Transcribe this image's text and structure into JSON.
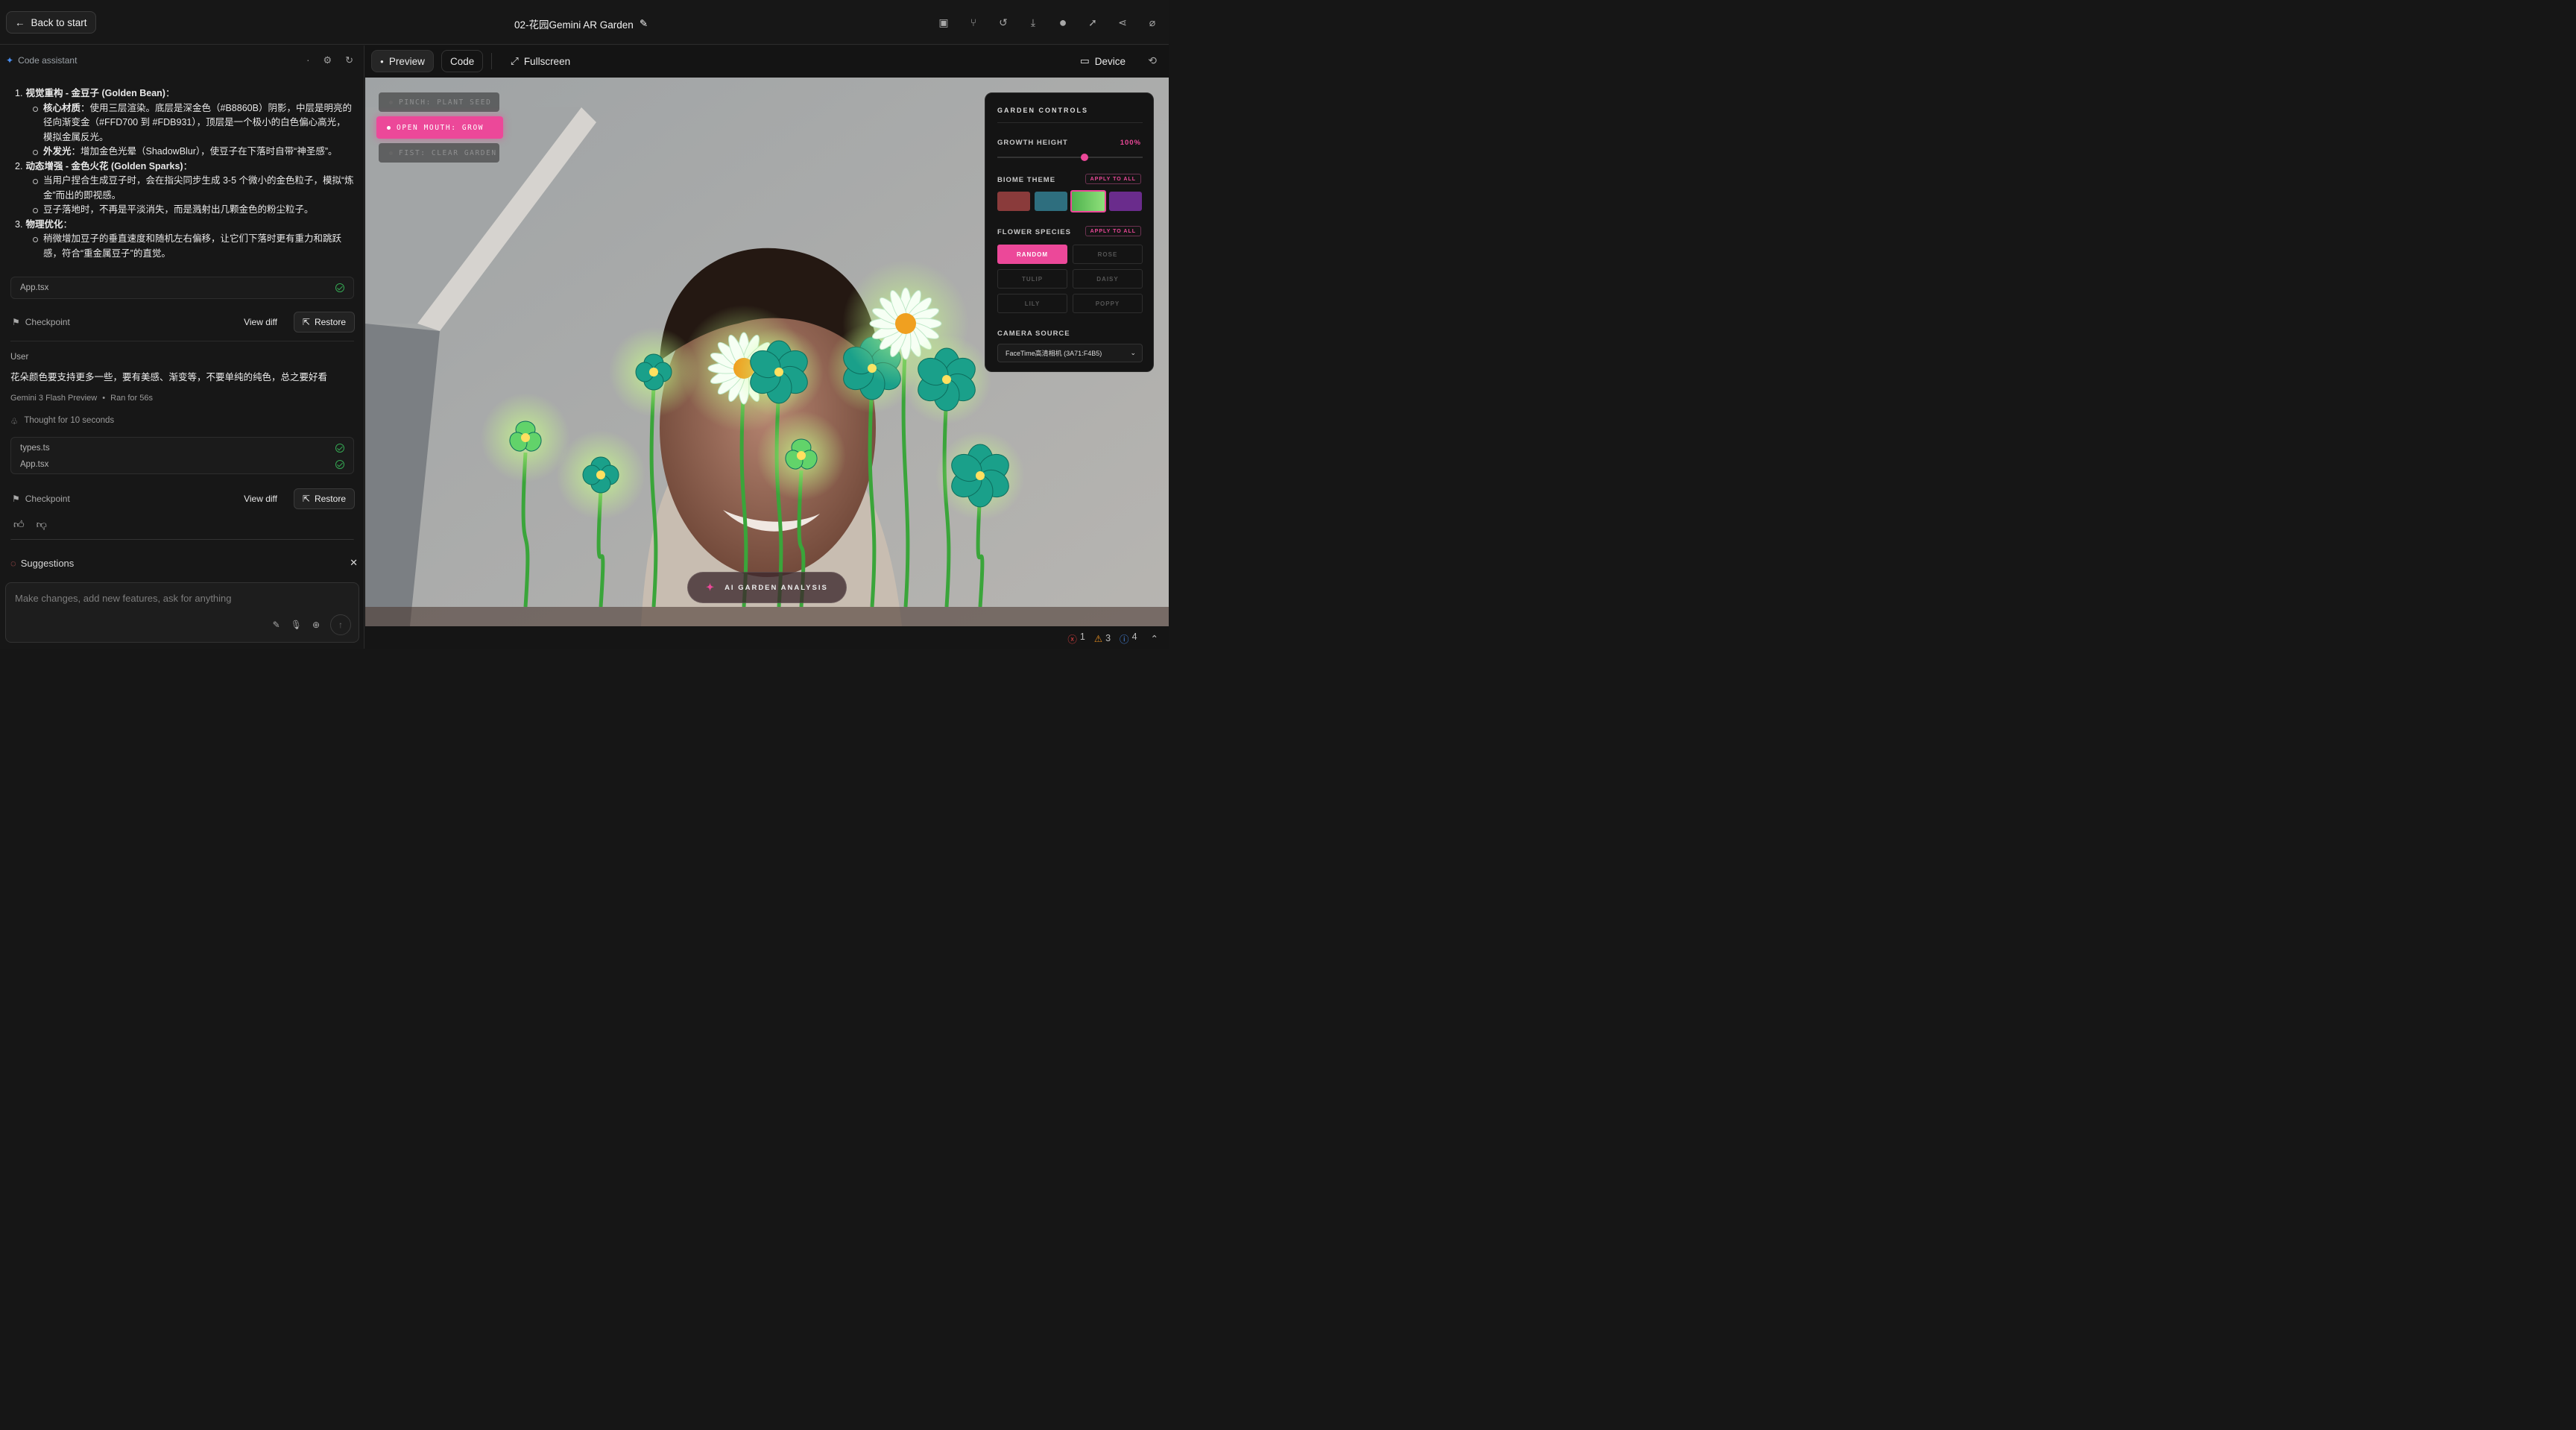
{
  "topbar": {
    "back_label": "Back to start",
    "project_title": "02-花园Gemini AR Garden",
    "icons": [
      "save-icon",
      "branch-icon",
      "history-icon",
      "download-icon",
      "github-icon",
      "deploy-icon",
      "share-icon",
      "hide-icon"
    ]
  },
  "assistant": {
    "header": "Code assistant",
    "message": [
      {
        "num": "1.",
        "title": "视觉重构 - 金豆子 (Golden Bean)",
        "bullets": [
          {
            "bold": "核心材质",
            "text": "：使用三层渲染。底层是深金色（#B8860B）阴影，中层是明亮的径向渐变金（#FFD700 到 #FDB931），顶层是一个极小的白色偏心高光，模拟金属反光。"
          },
          {
            "bold": "外发光",
            "text": "：增加金色光晕（ShadowBlur），使豆子在下落时自带“神圣感”。"
          }
        ]
      },
      {
        "num": "2.",
        "title": "动态增强 - 金色火花 (Golden Sparks)",
        "bullets": [
          {
            "bold": "",
            "text": "当用户捏合生成豆子时，会在指尖同步生成 3-5 个微小的金色粒子，模拟“炼金”而出的即视感。"
          },
          {
            "bold": "",
            "text": "豆子落地时，不再是平淡消失，而是溅射出几颗金色的粉尘粒子。"
          }
        ]
      },
      {
        "num": "3.",
        "title": "物理优化",
        "bullets": [
          {
            "bold": "",
            "text": "稍微增加豆子的垂直速度和随机左右偏移，让它们下落时更有重力和跳跃感，符合“重金属豆子”的直觉。"
          }
        ]
      }
    ],
    "file1": "App.tsx",
    "checkpoint_label": "Checkpoint",
    "view_diff": "View diff",
    "restore": "Restore",
    "user_label": "User",
    "user_message": "花朵颜色要支持更多一些，要有美感、渐变等，不要单纯的纯色，总之要好看",
    "model": "Gemini 3 Flash Preview",
    "ran_for": "Ran for 56s",
    "thought": "Thought for 10 seconds",
    "files2": [
      "types.ts",
      "App.tsx"
    ],
    "suggestions": "Suggestions",
    "input_placeholder": "Make changes, add new features, ask for anything"
  },
  "preview_tabs": {
    "preview": "Preview",
    "code": "Code",
    "fullscreen": "Fullscreen",
    "device": "Device"
  },
  "gestures": [
    {
      "label": "PINCH: PLANT SEED",
      "active": false
    },
    {
      "label": "OPEN MOUTH: GROW",
      "active": true
    },
    {
      "label": "FIST: CLEAR GARDEN",
      "active": false
    }
  ],
  "garden_controls": {
    "title": "GARDEN CONTROLS",
    "growth_label": "GROWTH HEIGHT",
    "growth_value": "100%",
    "growth_fraction": 0.6,
    "biome_label": "BIOME THEME",
    "apply_all": "APPLY TO ALL",
    "biome_colors": [
      "#8a3b3b",
      "#2e6e7e",
      "#5bbf5b",
      "#6a2c8c"
    ],
    "biome_selected": 2,
    "species_label": "FLOWER SPECIES",
    "species": [
      "RANDOM",
      "ROSE",
      "TULIP",
      "DAISY",
      "LILY",
      "POPPY"
    ],
    "species_selected": 0,
    "camera_label": "CAMERA SOURCE",
    "camera_value": "FaceTime高清相机 (3A71:F4B5)",
    "accent": "#ec4899"
  },
  "ai_button": "AI GARDEN ANALYSIS",
  "status": {
    "errors": "1",
    "warnings": "3",
    "info": "4"
  }
}
